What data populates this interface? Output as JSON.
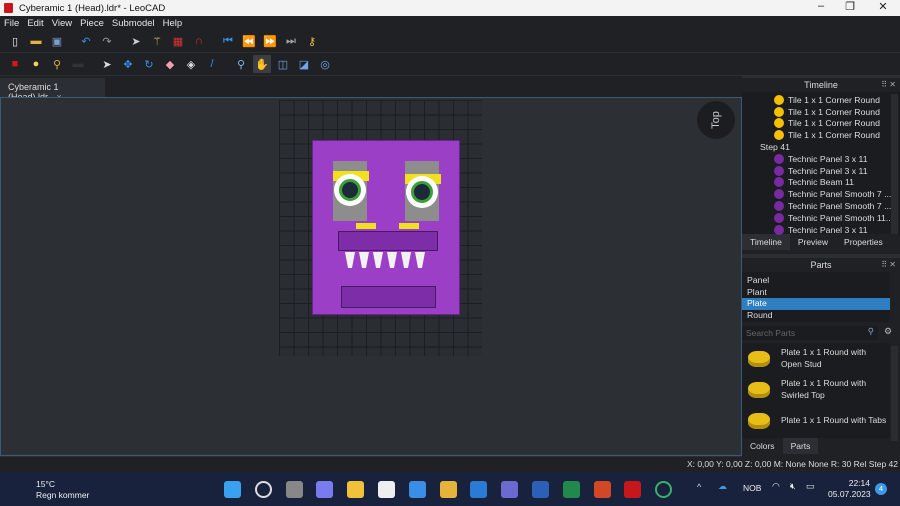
{
  "window": {
    "title": "Cyberamic 1 (Head).ldr* - LeoCAD",
    "controls": [
      "minimize",
      "restore",
      "close"
    ]
  },
  "menu": [
    "File",
    "Edit",
    "View",
    "Piece",
    "Submodel",
    "Help"
  ],
  "toolbar1": [
    {
      "icon": "new-file-icon",
      "g": "▯",
      "c": "#f0f0f0"
    },
    {
      "icon": "open-folder-icon",
      "g": "▬",
      "c": "#e8b33a"
    },
    {
      "icon": "save-icon",
      "g": "▣",
      "c": "#7aa0d0"
    },
    {
      "icon": "undo-icon",
      "g": "↶",
      "c": "#3a8ee6"
    },
    {
      "icon": "redo-icon",
      "g": "↷",
      "c": "#999"
    },
    {
      "icon": "select-icon",
      "g": "➤",
      "c": "#ccc"
    },
    {
      "icon": "magic-wand-icon",
      "g": "⚚",
      "c": "#e6d23a"
    },
    {
      "icon": "grid-snap-icon",
      "g": "▦",
      "c": "#d33"
    },
    {
      "icon": "angle-snap-icon",
      "g": "∩",
      "c": "#d33"
    },
    {
      "icon": "first-step-icon",
      "g": "⏮",
      "c": "#3a8ee6"
    },
    {
      "icon": "previous-step-icon",
      "g": "⏪",
      "c": "#3a8ee6"
    },
    {
      "icon": "next-step-icon",
      "g": "⏩",
      "c": "#3a8ee6"
    },
    {
      "icon": "last-step-icon",
      "g": "⏭",
      "c": "#aaa"
    },
    {
      "icon": "key-icon",
      "g": "⚷",
      "c": "#e6c53a"
    }
  ],
  "toolbar2": [
    {
      "icon": "brick-icon",
      "g": "■",
      "c": "#d01a1a"
    },
    {
      "icon": "light-bulb-icon",
      "g": "●",
      "c": "#f3d55a"
    },
    {
      "icon": "spotlight-icon",
      "g": "⚲",
      "c": "#e6b33a"
    },
    {
      "icon": "camera-icon",
      "g": "▬",
      "c": "#333"
    },
    {
      "icon": "pointer-icon",
      "g": "➤",
      "c": "#ddd"
    },
    {
      "icon": "move-icon",
      "g": "✥",
      "c": "#3a8ee6"
    },
    {
      "icon": "rotate-icon",
      "g": "↻",
      "c": "#3a8ee6"
    },
    {
      "icon": "eraser-icon",
      "g": "◆",
      "c": "#f0a0b0"
    },
    {
      "icon": "paint-icon",
      "g": "◈",
      "c": "#ddd"
    },
    {
      "icon": "eyedropper-icon",
      "g": "/",
      "c": "#3a8ee6"
    },
    {
      "icon": "zoom-icon",
      "g": "⚲",
      "c": "#8ab4e6"
    },
    {
      "icon": "pan-hand-icon",
      "g": "✋",
      "c": "#e6a56a"
    },
    {
      "icon": "rotate-view-icon",
      "g": "◫",
      "c": "#6fa6e6"
    },
    {
      "icon": "zoom-region-icon",
      "g": "◪",
      "c": "#6fa6e6"
    },
    {
      "icon": "zoom-extents-icon",
      "g": "◎",
      "c": "#6fa6e6"
    }
  ],
  "document_tab": {
    "label": "Cyberamic 1 (Head).ldr",
    "close": "×"
  },
  "viewport": {
    "view_cube_label": "Top",
    "model_colors": {
      "body": "#9b3fc7",
      "brow": "#f0e020",
      "iris": "#3ba03a",
      "teeth": "#f2f2f2"
    }
  },
  "timeline": {
    "title": "Timeline",
    "items": [
      {
        "type": "piece",
        "label": "Tile  1 x  1 Corner Round",
        "color": "#f5c000"
      },
      {
        "type": "piece",
        "label": "Tile  1 x  1 Corner Round",
        "color": "#f5c000"
      },
      {
        "type": "piece",
        "label": "Tile  1 x  1 Corner Round",
        "color": "#f5c000"
      },
      {
        "type": "piece",
        "label": "Tile  1 x  1 Corner Round",
        "color": "#f5c000"
      },
      {
        "type": "step",
        "label": "Step 41"
      },
      {
        "type": "piece",
        "label": "Technic Panel  3 x 11",
        "color": "#7a2aa0"
      },
      {
        "type": "piece",
        "label": "Technic Panel  3 x 11",
        "color": "#7a2aa0"
      },
      {
        "type": "piece",
        "label": "Technic Beam 11",
        "color": "#7a2aa0"
      },
      {
        "type": "piece",
        "label": "Technic Panel Smooth  7 ...",
        "color": "#7a2aa0"
      },
      {
        "type": "piece",
        "label": "Technic Panel Smooth  7 ...",
        "color": "#7a2aa0"
      },
      {
        "type": "piece",
        "label": "Technic Panel Smooth 11...",
        "color": "#7a2aa0"
      },
      {
        "type": "piece",
        "label": "Technic Panel  3 x 11",
        "color": "#7a2aa0"
      }
    ],
    "tabs": [
      "Timeline",
      "Preview",
      "Properties"
    ],
    "active_tab": "Timeline"
  },
  "parts": {
    "title": "Parts",
    "categories": [
      "Panel",
      "Plant",
      "Plate",
      "Round"
    ],
    "selected_category": "Plate",
    "search_placeholder": "Search Parts",
    "list": [
      {
        "line1": "Plate  1 x  1 Round with",
        "line2": "Open Stud"
      },
      {
        "line1": "Plate  1 x  1 Round with",
        "line2": "Swirled Top"
      },
      {
        "line1": "Plate  1 x  1 Round with Tabs",
        "line2": ""
      }
    ],
    "tabs": [
      "Colors",
      "Parts"
    ],
    "active_tab": "Parts"
  },
  "status": "X: 0,00 Y: 0,00 Z: 0,00  M: None None R: 30 Rel  Step 42",
  "taskbar": {
    "weather_temp": "15°C",
    "weather_text": "Regn kommer",
    "language": "NOB",
    "time": "22:14",
    "date": "05.07.2023",
    "notifications": "4",
    "apps": [
      "start",
      "search",
      "task-view",
      "meet",
      "file-explorer",
      "store",
      "edge-dev",
      "chrome",
      "outlook",
      "teams",
      "word",
      "excel",
      "powerpoint",
      "leocad",
      "stud-io"
    ]
  }
}
